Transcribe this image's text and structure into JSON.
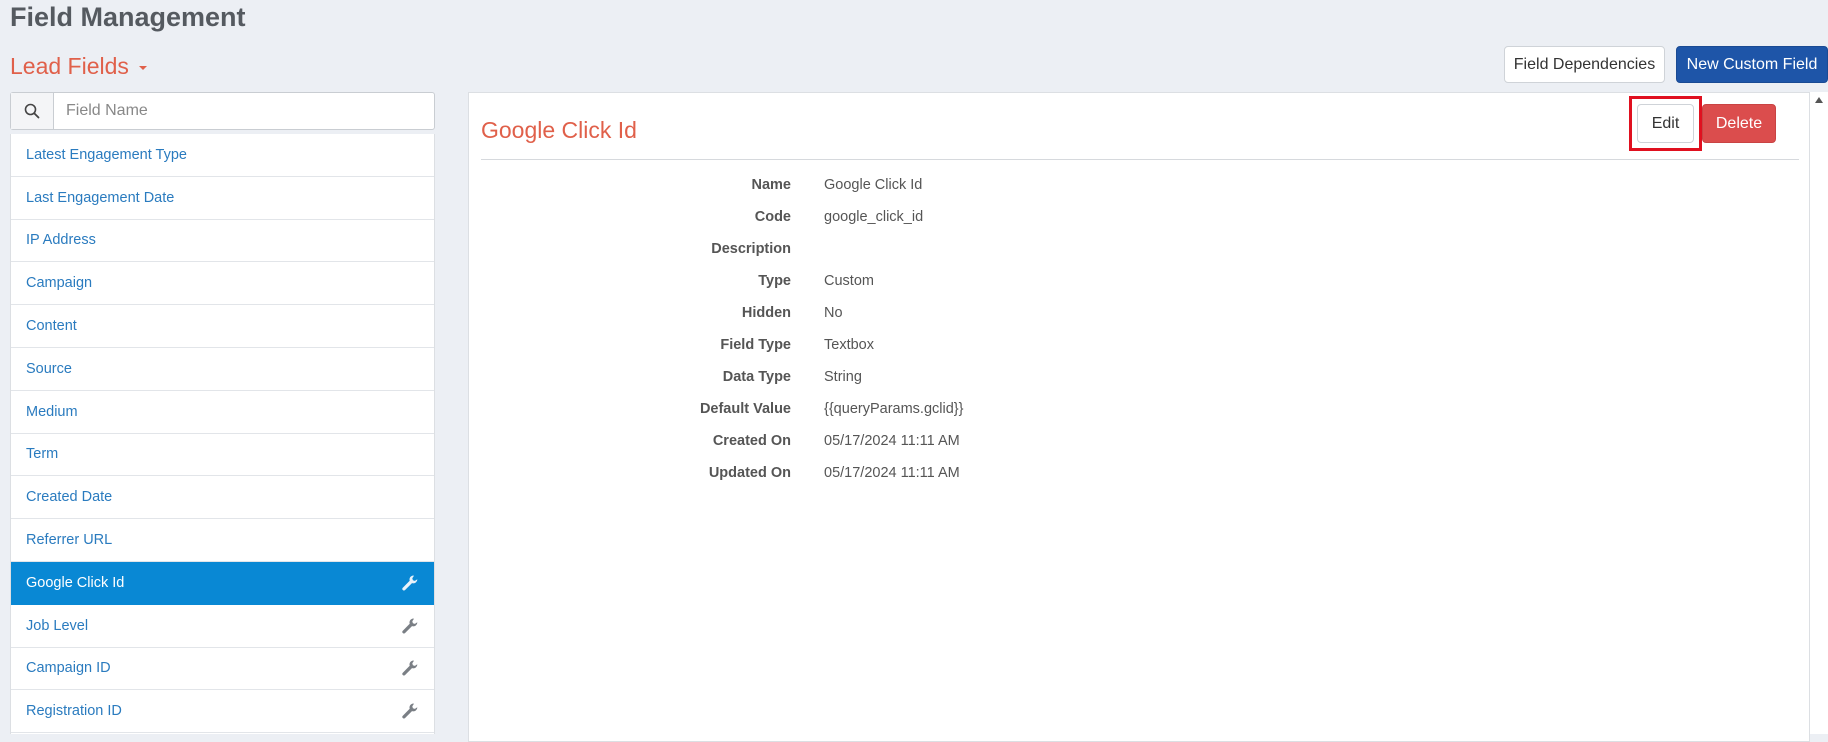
{
  "header": {
    "title": "Field Management",
    "section": "Lead Fields",
    "field_dependencies_label": "Field Dependencies",
    "new_custom_field_label": "New Custom Field"
  },
  "search": {
    "placeholder": "Field Name",
    "value": ""
  },
  "field_list": [
    {
      "label": "Latest Engagement Type",
      "editable": false,
      "selected": false
    },
    {
      "label": "Last Engagement Date",
      "editable": false,
      "selected": false
    },
    {
      "label": "IP Address",
      "editable": false,
      "selected": false
    },
    {
      "label": "Campaign",
      "editable": false,
      "selected": false
    },
    {
      "label": "Content",
      "editable": false,
      "selected": false
    },
    {
      "label": "Source",
      "editable": false,
      "selected": false
    },
    {
      "label": "Medium",
      "editable": false,
      "selected": false
    },
    {
      "label": "Term",
      "editable": false,
      "selected": false
    },
    {
      "label": "Created Date",
      "editable": false,
      "selected": false
    },
    {
      "label": "Referrer URL",
      "editable": false,
      "selected": false
    },
    {
      "label": "Google Click Id",
      "editable": true,
      "selected": true
    },
    {
      "label": "Job Level",
      "editable": true,
      "selected": false
    },
    {
      "label": "Campaign ID",
      "editable": true,
      "selected": false
    },
    {
      "label": "Registration ID",
      "editable": true,
      "selected": false
    }
  ],
  "detail": {
    "title": "Google Click Id",
    "edit_label": "Edit",
    "delete_label": "Delete",
    "properties": [
      {
        "label": "Name",
        "value": "Google Click Id"
      },
      {
        "label": "Code",
        "value": "google_click_id"
      },
      {
        "label": "Description",
        "value": ""
      },
      {
        "label": "Type",
        "value": "Custom"
      },
      {
        "label": "Hidden",
        "value": "No"
      },
      {
        "label": "Field Type",
        "value": "Textbox"
      },
      {
        "label": "Data Type",
        "value": "String"
      },
      {
        "label": "Default Value",
        "value": "{{queryParams.gclid}}"
      },
      {
        "label": "Created On",
        "value": "05/17/2024 11:11 AM"
      },
      {
        "label": "Updated On",
        "value": "05/17/2024 11:11 AM"
      }
    ]
  },
  "colors": {
    "accent_orange": "#e0604a",
    "primary_blue": "#1e55a8",
    "selected_blue": "#0988d4",
    "danger_red": "#db4d4d",
    "highlight_red": "#e0101f",
    "link_blue": "#2a7bbf"
  },
  "icons": {
    "search": "search-icon",
    "wrench": "wrench-icon",
    "caret": "caret-down-icon"
  }
}
